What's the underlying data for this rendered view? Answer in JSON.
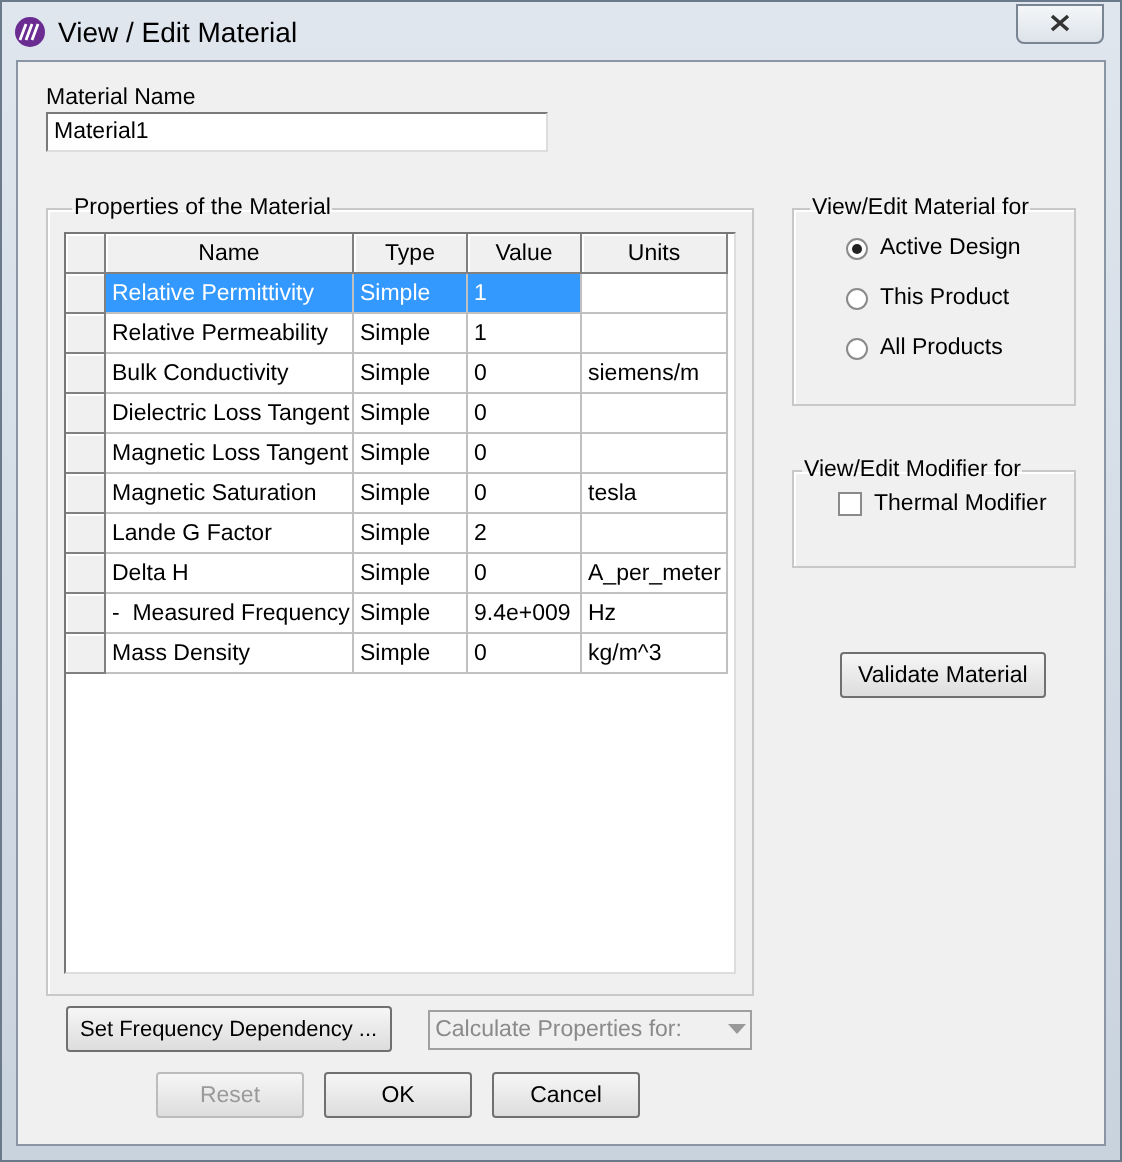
{
  "window": {
    "title": "View / Edit Material"
  },
  "material_name": {
    "label": "Material Name",
    "value": "Material1"
  },
  "properties": {
    "title": "Properties of the Material",
    "columns": [
      "Name",
      "Type",
      "Value",
      "Units"
    ],
    "rows": [
      {
        "name": "Relative Permittivity",
        "type": "Simple",
        "value": "1",
        "units": "",
        "selected": true
      },
      {
        "name": "Relative Permeability",
        "type": "Simple",
        "value": "1",
        "units": "",
        "selected": false
      },
      {
        "name": "Bulk Conductivity",
        "type": "Simple",
        "value": "0",
        "units": "siemens/m",
        "selected": false
      },
      {
        "name": "Dielectric Loss Tangent",
        "type": "Simple",
        "value": "0",
        "units": "",
        "selected": false
      },
      {
        "name": "Magnetic Loss Tangent",
        "type": "Simple",
        "value": "0",
        "units": "",
        "selected": false
      },
      {
        "name": "Magnetic Saturation",
        "type": "Simple",
        "value": "0",
        "units": "tesla",
        "selected": false
      },
      {
        "name": "Lande G Factor",
        "type": "Simple",
        "value": "2",
        "units": "",
        "selected": false
      },
      {
        "name": "Delta H",
        "type": "Simple",
        "value": "0",
        "units": "A_per_meter",
        "selected": false
      },
      {
        "name": "-  Measured Frequency",
        "type": "Simple",
        "value": "9.4e+009",
        "units": "Hz",
        "selected": false
      },
      {
        "name": "Mass Density",
        "type": "Simple",
        "value": "0",
        "units": "kg/m^3",
        "selected": false
      }
    ]
  },
  "edit_for": {
    "title": "View/Edit Material for",
    "options": [
      {
        "label": "Active Design",
        "selected": true
      },
      {
        "label": "This Product",
        "selected": false
      },
      {
        "label": "All Products",
        "selected": false
      }
    ]
  },
  "modifier_for": {
    "title": "View/Edit Modifier for",
    "options": [
      {
        "label": "Thermal Modifier",
        "checked": false
      }
    ]
  },
  "validate_button": "Validate Material",
  "frequency_button": "Set Frequency Dependency ...",
  "calculate_dropdown": {
    "value": "Calculate Properties for:",
    "disabled": true
  },
  "buttons": [
    {
      "label": "Reset",
      "disabled": true
    },
    {
      "label": "OK",
      "disabled": false
    },
    {
      "label": "Cancel",
      "disabled": false
    }
  ]
}
